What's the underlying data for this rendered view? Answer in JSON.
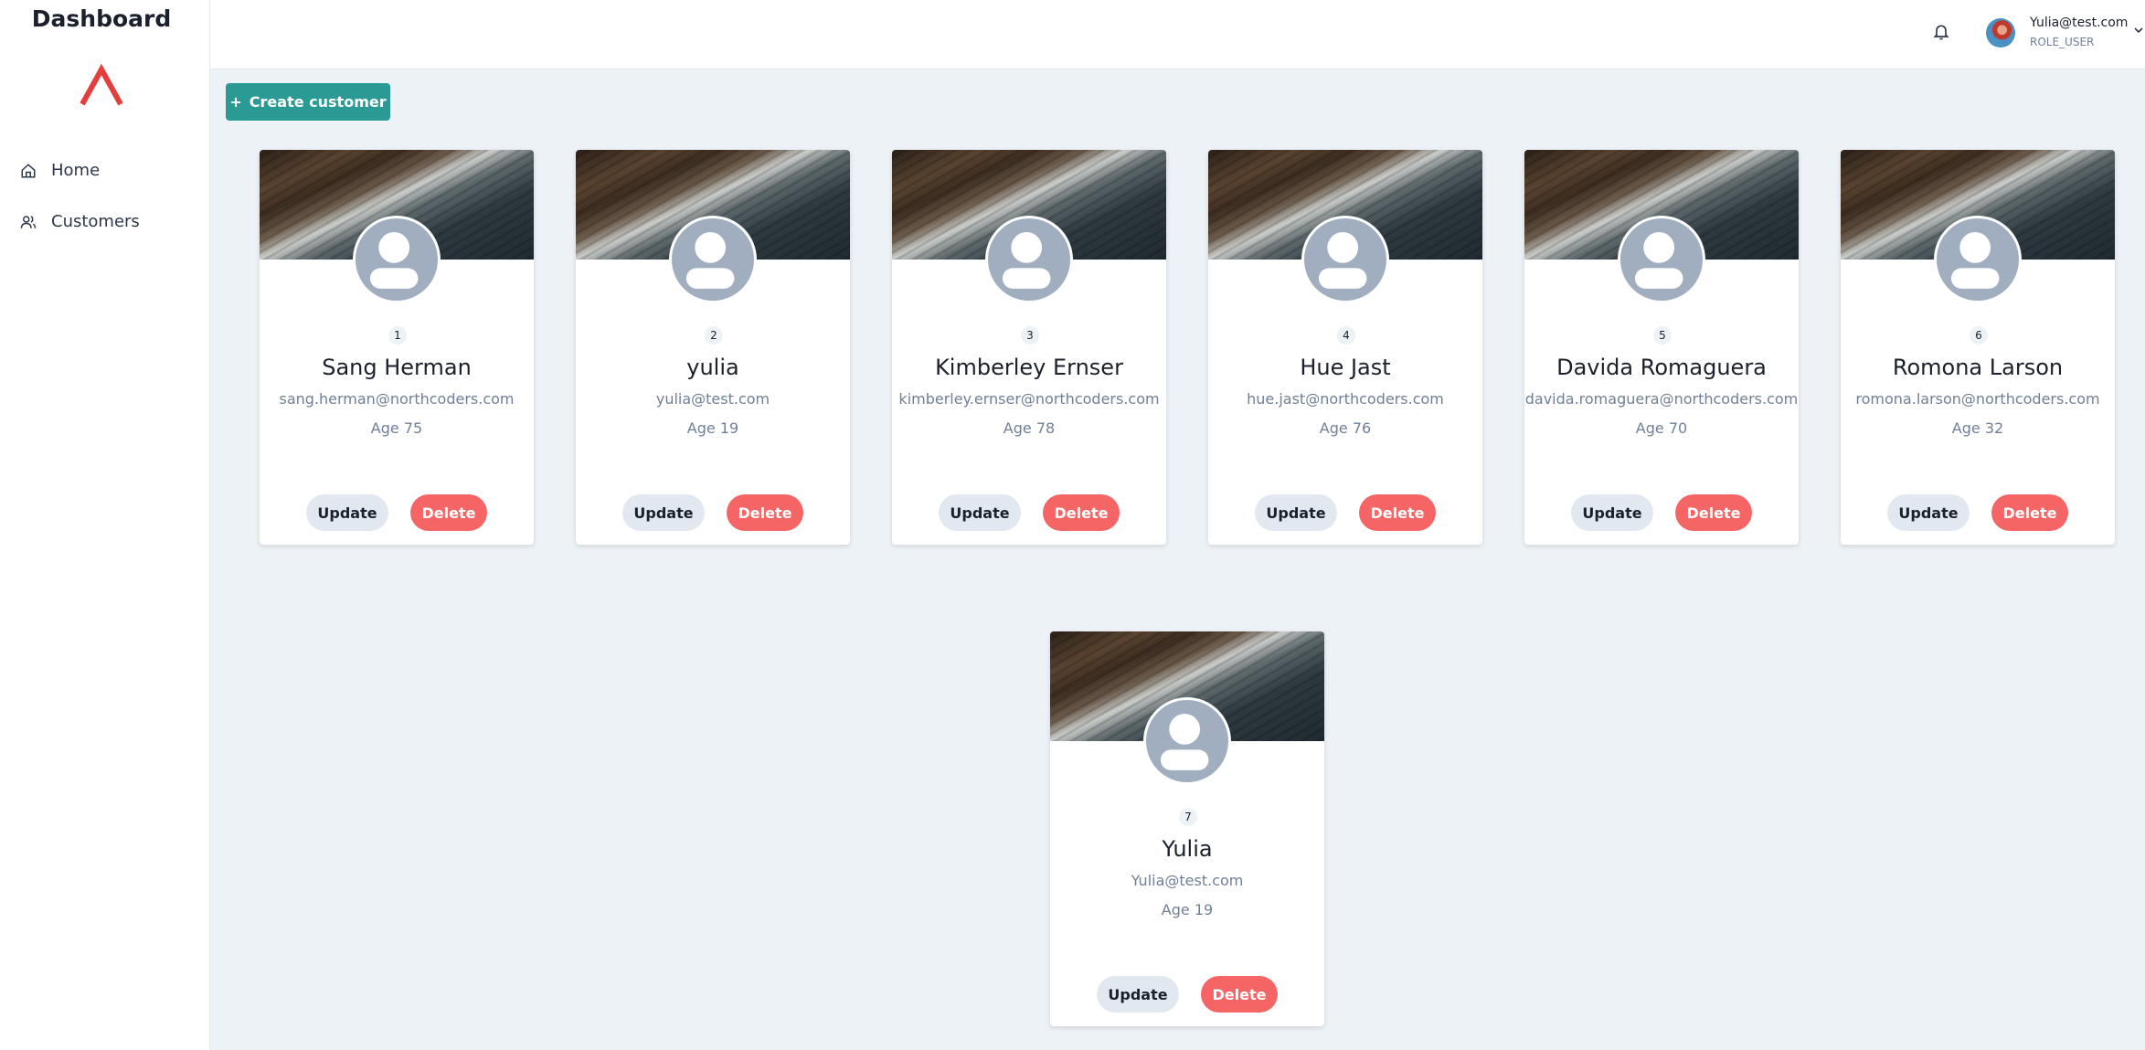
{
  "sidebar": {
    "title": "Dashboard",
    "items": [
      {
        "label": "Home",
        "icon": "home-icon"
      },
      {
        "label": "Customers",
        "icon": "users-icon"
      }
    ]
  },
  "header": {
    "user_email": "Yulia@test.com",
    "user_role": "ROLE_USER"
  },
  "actions": {
    "create_label": "Create customer",
    "create_icon_text": "+"
  },
  "colors": {
    "brand_red": "#e53e3e",
    "create_button": "#2c9a94",
    "delete_button": "#f56565",
    "update_button": "#e2e8f0",
    "background": "#edf2f7"
  },
  "customers": [
    {
      "id": "1",
      "name": "Sang Herman",
      "email": "sang.herman@northcoders.com",
      "age": "Age 75",
      "update_label": "Update",
      "delete_label": "Delete"
    },
    {
      "id": "2",
      "name": "yulia",
      "email": "yulia@test.com",
      "age": "Age 19",
      "update_label": "Update",
      "delete_label": "Delete"
    },
    {
      "id": "3",
      "name": "Kimberley Ernser",
      "email": "kimberley.ernser@northcoders.com",
      "age": "Age 78",
      "update_label": "Update",
      "delete_label": "Delete"
    },
    {
      "id": "4",
      "name": "Hue Jast",
      "email": "hue.jast@northcoders.com",
      "age": "Age 76",
      "update_label": "Update",
      "delete_label": "Delete"
    },
    {
      "id": "5",
      "name": "Davida Romaguera",
      "email": "davida.romaguera@northcoders.com",
      "age": "Age 70",
      "update_label": "Update",
      "delete_label": "Delete"
    },
    {
      "id": "6",
      "name": "Romona Larson",
      "email": "romona.larson@northcoders.com",
      "age": "Age 32",
      "update_label": "Update",
      "delete_label": "Delete"
    },
    {
      "id": "7",
      "name": "Yulia",
      "email": "Yulia@test.com",
      "age": "Age 19",
      "update_label": "Update",
      "delete_label": "Delete"
    }
  ]
}
